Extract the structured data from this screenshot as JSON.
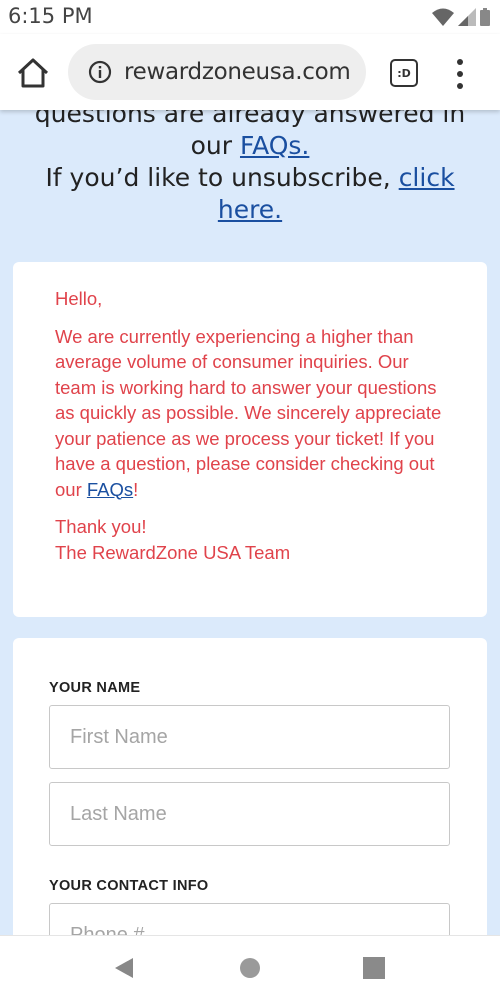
{
  "status_bar": {
    "time": "6:15 PM"
  },
  "browser": {
    "url": "rewardzoneusa.com",
    "tabs_label": ":D",
    "icons": {
      "home": "home-icon",
      "info": "info-icon",
      "menu": "more-vert-icon"
    }
  },
  "header": {
    "line1": "questions are already answered in",
    "line2_prefix": "our ",
    "faqs_link": "FAQs.",
    "line3_prefix": "If you’d like to unsubscribe, ",
    "click_link": "click",
    "here_link": "here."
  },
  "notice": {
    "greeting": "Hello,",
    "body": "We are currently experiencing a higher than average volume of consumer inquiries. Our team is working hard to answer your questions as quickly as possible. We sincerely appreciate your patience as we process your ticket! If you have a question, please consider checking out our ",
    "faqs_link": "FAQs",
    "body_end": "!",
    "thanks": "Thank you!",
    "signature": "The RewardZone USA Team"
  },
  "form": {
    "name_label": "YOUR NAME",
    "first_name_placeholder": "First Name",
    "last_name_placeholder": "Last Name",
    "contact_label": "YOUR CONTACT INFO",
    "phone_placeholder": "Phone #"
  },
  "colors": {
    "page_bg": "#dbeafb",
    "notice_text": "#e0434b",
    "link": "#1a4fa0"
  }
}
